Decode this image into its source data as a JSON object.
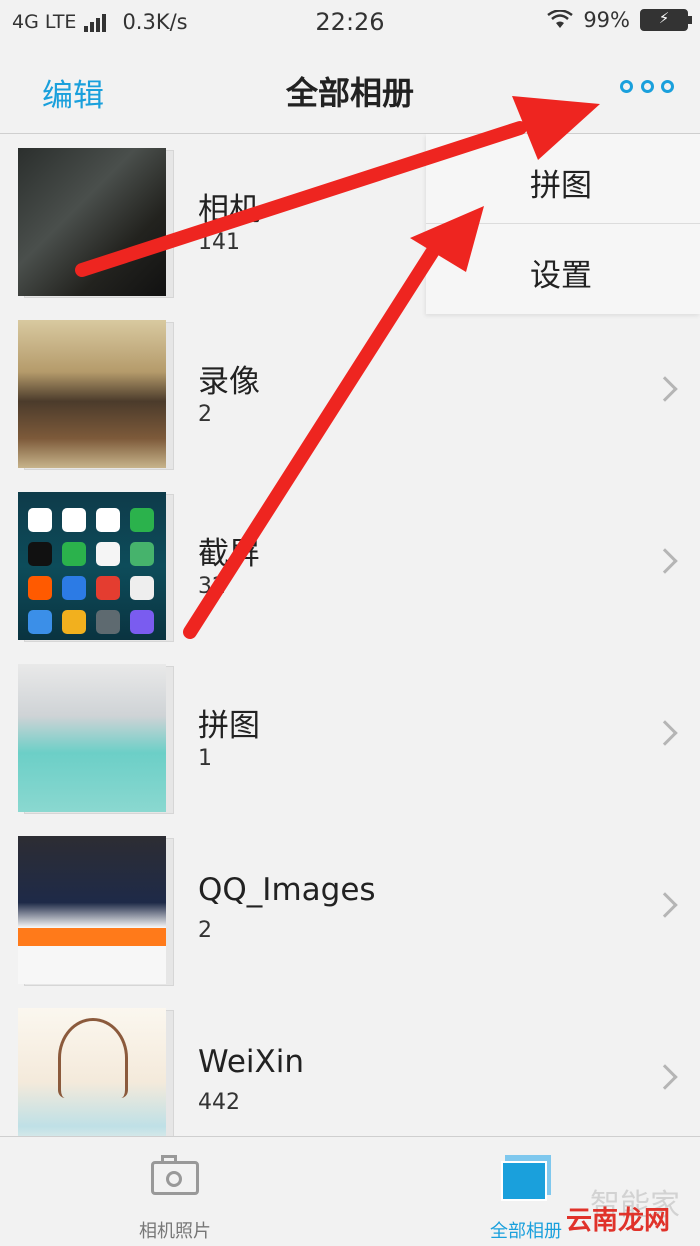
{
  "status_bar": {
    "network": "4G LTE",
    "speed": "0.3K/s",
    "time": "22:26",
    "battery": "99%"
  },
  "nav": {
    "edit": "编辑",
    "title": "全部相册",
    "more_icon": "more-dots-icon"
  },
  "albums": [
    {
      "name": "相机",
      "count": "141"
    },
    {
      "name": "录像",
      "count": "2"
    },
    {
      "name": "截屏",
      "count": "32"
    },
    {
      "name": "拼图",
      "count": "1"
    },
    {
      "name": "QQ_Images",
      "count": "2"
    },
    {
      "name": "WeiXin",
      "count": "442"
    }
  ],
  "popup_menu": {
    "items": [
      {
        "label": "拼图"
      },
      {
        "label": "设置"
      }
    ]
  },
  "tabs": [
    {
      "label": "相机照片",
      "icon": "camera-icon",
      "active": false
    },
    {
      "label": "全部相册",
      "icon": "albums-icon",
      "active": true
    }
  ],
  "watermark": {
    "text": "智能家",
    "brand": "云南龙网"
  },
  "colors": {
    "accent": "#1aa0dc",
    "arrow": "#ee2520",
    "background": "#f2f2f2"
  }
}
